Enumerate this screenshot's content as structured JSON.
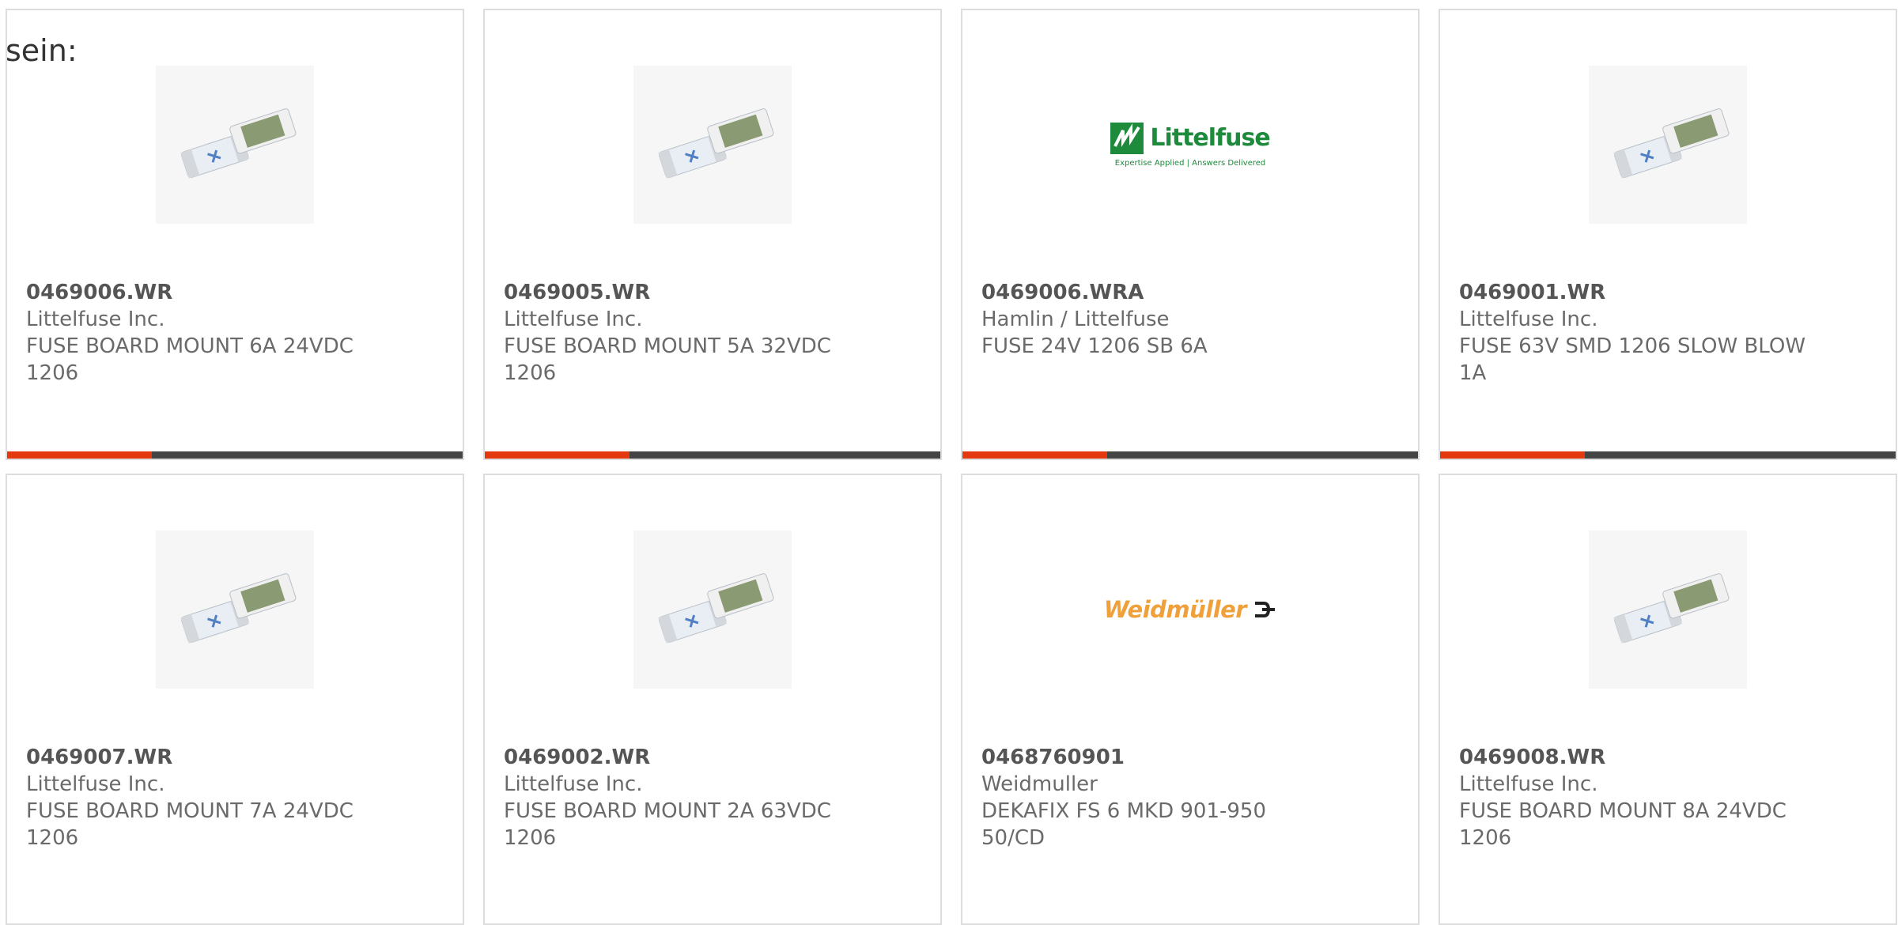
{
  "intro": "sein:",
  "colors": {
    "accent_red": "#e4380f",
    "accent_dark": "#444444",
    "border": "#dddddd"
  },
  "products": [
    {
      "part": "0469006.WR",
      "mfr": "Littelfuse Inc.",
      "desc": [
        "FUSE BOARD MOUNT 6A 24VDC",
        "1206"
      ],
      "image": "smd-fuse-photo",
      "accent": true
    },
    {
      "part": "0469005.WR",
      "mfr": "Littelfuse Inc.",
      "desc": [
        "FUSE BOARD MOUNT 5A 32VDC",
        "1206"
      ],
      "image": "smd-fuse-photo",
      "accent": true
    },
    {
      "part": "0469006.WRA",
      "mfr": "Hamlin / Littelfuse",
      "desc": [
        "FUSE 24V 1206 SB 6A"
      ],
      "image": "littelfuse-logo",
      "logo_name": "Littelfuse",
      "logo_tagline": "Expertise Applied | Answers Delivered",
      "accent": true
    },
    {
      "part": "0469001.WR",
      "mfr": "Littelfuse Inc.",
      "desc": [
        "FUSE 63V SMD 1206 SLOW BLOW",
        "1A"
      ],
      "image": "smd-fuse-photo",
      "accent": true
    },
    {
      "part": "0469007.WR",
      "mfr": "Littelfuse Inc.",
      "desc": [
        "FUSE BOARD MOUNT 7A 24VDC",
        "1206"
      ],
      "image": "smd-fuse-photo",
      "accent": false
    },
    {
      "part": "0469002.WR",
      "mfr": "Littelfuse Inc.",
      "desc": [
        "FUSE BOARD MOUNT 2A 63VDC",
        "1206"
      ],
      "image": "smd-fuse-photo",
      "accent": false
    },
    {
      "part": "0468760901",
      "mfr": "Weidmuller",
      "desc": [
        "DEKAFIX FS 6 MKD 901-950",
        "50/CD"
      ],
      "image": "weidmuller-logo",
      "logo_name": "Weidmüller",
      "accent": false
    },
    {
      "part": "0469008.WR",
      "mfr": "Littelfuse Inc.",
      "desc": [
        "FUSE BOARD MOUNT 8A 24VDC",
        "1206"
      ],
      "image": "smd-fuse-photo",
      "accent": false
    }
  ]
}
